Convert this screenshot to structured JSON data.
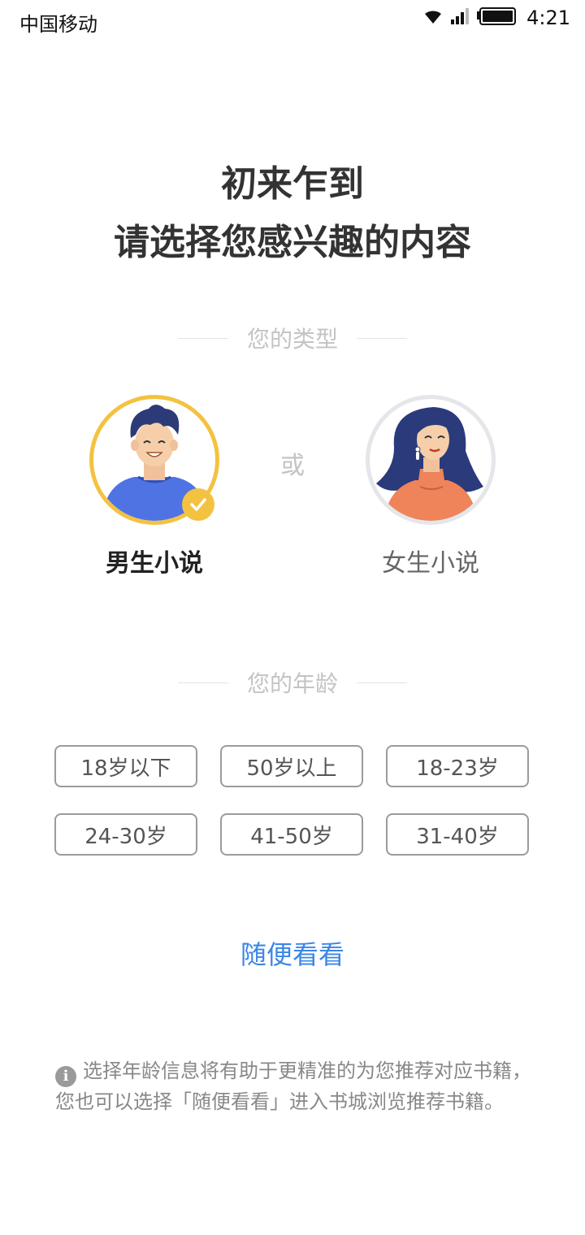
{
  "status_bar": {
    "carrier": "中国移动",
    "time": "4:21"
  },
  "title": {
    "line1": "初来乍到",
    "line2": "请选择您感兴趣的内容"
  },
  "type_section": {
    "heading": "您的类型",
    "or_label": "或",
    "options": [
      {
        "label": "男生小说",
        "selected": true
      },
      {
        "label": "女生小说",
        "selected": false
      }
    ]
  },
  "age_section": {
    "heading": "您的年龄",
    "options": [
      "18岁以下",
      "50岁以上",
      "18-23岁",
      "24-30岁",
      "41-50岁",
      "31-40岁"
    ]
  },
  "random_link": "随便看看",
  "info_text": "选择年龄信息将有助于更精准的为您推荐对应书籍，您也可以选择「随便看看」进入书城浏览推荐书籍。",
  "colors": {
    "accent_yellow": "#f4c241",
    "link_blue": "#3b86e6",
    "female_ring": "#e5e6ea"
  }
}
